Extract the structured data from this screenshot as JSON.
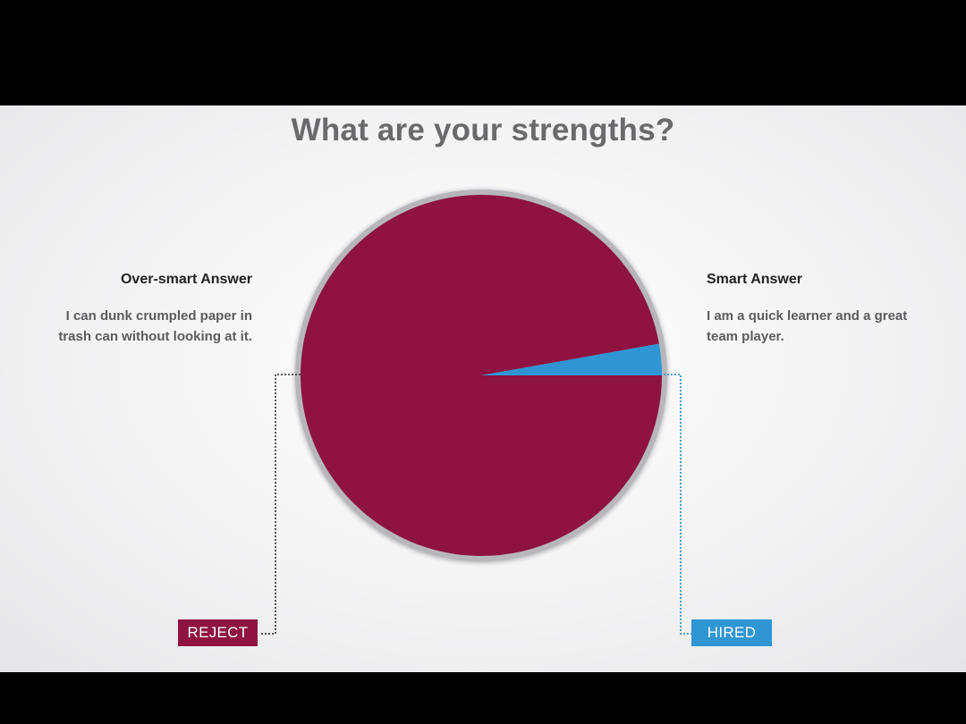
{
  "colors": {
    "reject": "#8e1341",
    "hired": "#2f96d3",
    "title_text": "#6a6a6d",
    "rim": "#b7b6bb"
  },
  "chart_data": {
    "type": "pie",
    "title": "What are your strengths?",
    "slices": [
      {
        "label": "Over-smart Answer",
        "value": 97.2,
        "outcome": "REJECT"
      },
      {
        "label": "Smart Answer",
        "value": 2.8,
        "outcome": "HIRED"
      }
    ]
  },
  "left": {
    "heading": "Over-smart Answer",
    "text_line1": "I can dunk crumpled paper in",
    "text_line2": "trash can without looking at it.",
    "badge": "REJECT"
  },
  "right": {
    "heading": "Smart Answer",
    "text_line1": "I am a quick learner and a great",
    "text_line2": "team player.",
    "badge": "HIRED"
  }
}
